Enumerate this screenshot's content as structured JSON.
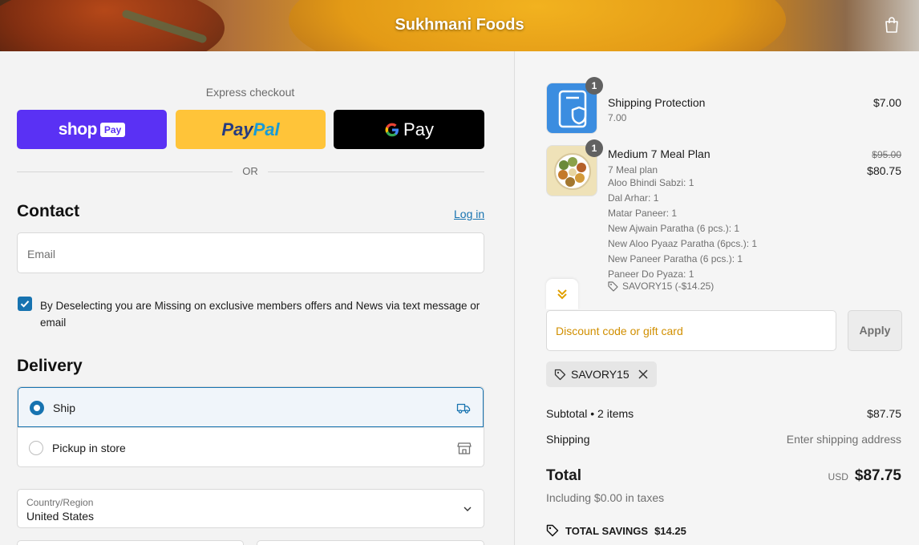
{
  "header": {
    "brand": "Sukhmani Foods",
    "cart_icon": "shopping-bag-icon"
  },
  "express": {
    "label": "Express checkout",
    "shop_text": "shop",
    "shop_badge": "Pay",
    "paypal_a": "Pay",
    "paypal_b": "Pal",
    "gpay_text": "Pay",
    "or": "OR"
  },
  "contact": {
    "heading": "Contact",
    "login": "Log in",
    "email_placeholder": "Email",
    "marketing_text": "By Deselecting you are Missing on exclusive members offers and News via text message or email"
  },
  "delivery": {
    "heading": "Delivery",
    "options": [
      {
        "label": "Ship",
        "icon": "truck-icon",
        "selected": true
      },
      {
        "label": "Pickup in store",
        "icon": "store-icon",
        "selected": false
      }
    ],
    "country_label": "Country/Region",
    "country_value": "United States"
  },
  "order": {
    "items": [
      {
        "name": "Shipping Protection",
        "sub": "7.00",
        "qty": "1",
        "price": "$7.00"
      },
      {
        "name": "Medium 7 Meal Plan",
        "sub": "7 Meal plan",
        "qty": "1",
        "original_price": "$95.00",
        "price": "$80.75",
        "details": [
          "Aloo Bhindi Sabzi: 1",
          "Dal Arhar: 1",
          "Matar Paneer: 1",
          "New Ajwain Paratha (6 pcs.): 1",
          "New Aloo Pyaaz Paratha (6pcs.): 1",
          "New Paneer Paratha (6 pcs.): 1",
          "Paneer Do Pyaza: 1"
        ],
        "discount_tag": "SAVORY15 (-$14.25)"
      }
    ],
    "discount_placeholder": "Discount code or gift card",
    "apply": "Apply",
    "applied_code": "SAVORY15",
    "subtotal_label": "Subtotal • 2 items",
    "subtotal_value": "$87.75",
    "shipping_label": "Shipping",
    "shipping_value": "Enter shipping address",
    "total_label": "Total",
    "currency": "USD",
    "total_value": "$87.75",
    "taxes": "Including $0.00 in taxes",
    "savings_label": "TOTAL SAVINGS",
    "savings_value": "$14.25"
  },
  "colors": {
    "accent": "#1773b0",
    "shop_pay": "#5a31f4",
    "paypal": "#ffc439",
    "discount_text": "#d18f00"
  }
}
